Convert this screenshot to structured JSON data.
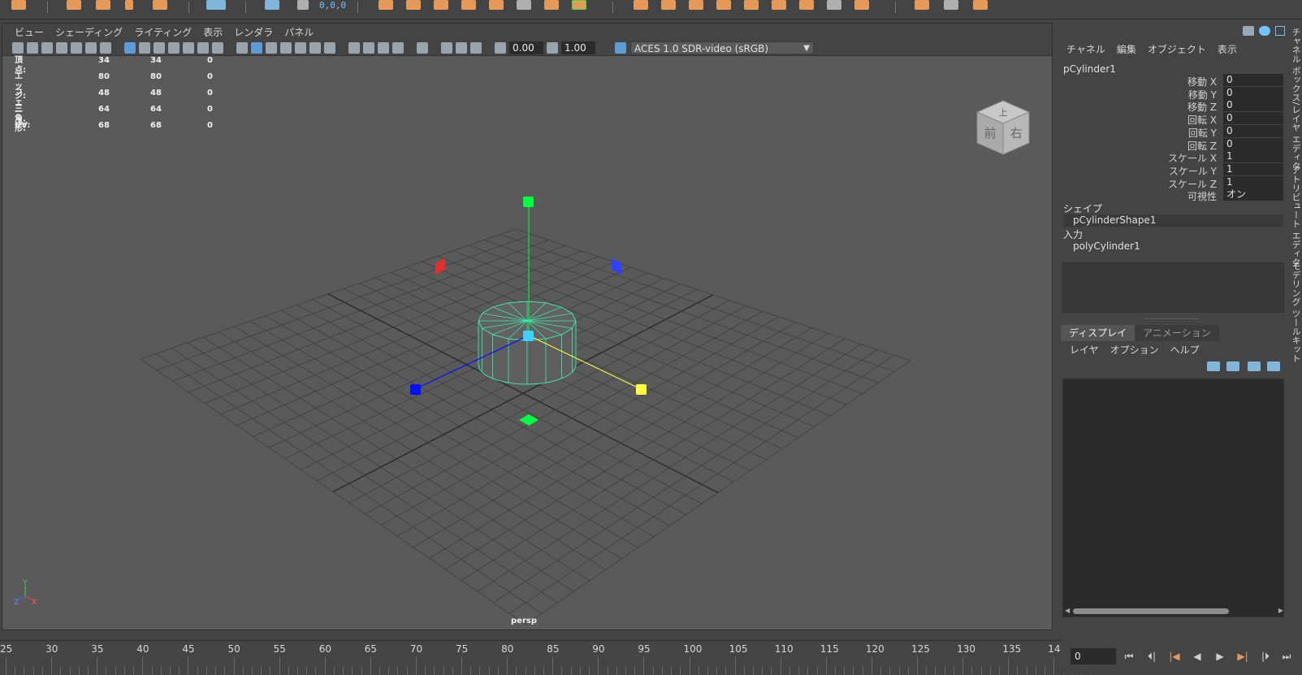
{
  "top_shelf": {
    "snap_readout": "0,0,0"
  },
  "panel_menu": [
    "ビュー",
    "シェーディング",
    "ライティング",
    "表示",
    "レンダラ",
    "パネル"
  ],
  "panel_toolbar": {
    "exposure": "0.00",
    "gamma": "1.00",
    "color_space": "ACES 1.0 SDR-video (sRGB)"
  },
  "hud": [
    {
      "label": "頂点:",
      "v1": "34",
      "v2": "34",
      "v3": "0"
    },
    {
      "label": "エッジ:",
      "v1": "80",
      "v2": "80",
      "v3": "0"
    },
    {
      "label": "フェース:",
      "v1": "48",
      "v2": "48",
      "v3": "0"
    },
    {
      "label": "三角形:",
      "v1": "64",
      "v2": "64",
      "v3": "0"
    },
    {
      "label": "UV:",
      "v1": "68",
      "v2": "68",
      "v3": "0"
    }
  ],
  "viewcube": {
    "top": "上",
    "front": "前",
    "right": "右"
  },
  "camera_label": "persp",
  "axis_labels": {
    "y": "Y",
    "z": "Z",
    "x": "X"
  },
  "channel_box": {
    "menu": [
      "チャネル",
      "編集",
      "オブジェクト",
      "表示"
    ],
    "object_name": "pCylinder1",
    "channels": [
      {
        "label": "移動 X",
        "value": "0"
      },
      {
        "label": "移動 Y",
        "value": "0"
      },
      {
        "label": "移動 Z",
        "value": "0"
      },
      {
        "label": "回転 X",
        "value": "0"
      },
      {
        "label": "回転 Y",
        "value": "0"
      },
      {
        "label": "回転 Z",
        "value": "0"
      },
      {
        "label": "スケール X",
        "value": "1"
      },
      {
        "label": "スケール Y",
        "value": "1"
      },
      {
        "label": "スケール Z",
        "value": "1"
      },
      {
        "label": "可視性",
        "value": "オン"
      }
    ],
    "shape_section": "シェイプ",
    "shape_node": "pCylinderShape1",
    "input_section": "入力",
    "input_node": "polyCylinder1"
  },
  "layer_editor": {
    "tabs": [
      "ディスプレイ",
      "アニメーション"
    ],
    "menu": [
      "レイヤ",
      "オプション",
      "ヘルプ"
    ]
  },
  "vertical_tabs": [
    "チャネル ボックス/レイヤ エディタ",
    "アトリビュート エディタ",
    "モデリング ツールキット"
  ],
  "time_slider": {
    "ticks": [
      "25",
      "30",
      "35",
      "40",
      "45",
      "50",
      "55",
      "60",
      "65",
      "70",
      "75",
      "80",
      "85",
      "90",
      "95",
      "100",
      "105",
      "110",
      "115",
      "120",
      "125",
      "130",
      "135",
      "14"
    ]
  },
  "playback": {
    "current_frame": "0"
  },
  "colors": {
    "wireframe": "#3cf0b0",
    "x_axis": "#ffff40",
    "y_axis": "#00ff40",
    "z_axis": "#0010ff",
    "accent": "#5e9bd4"
  }
}
